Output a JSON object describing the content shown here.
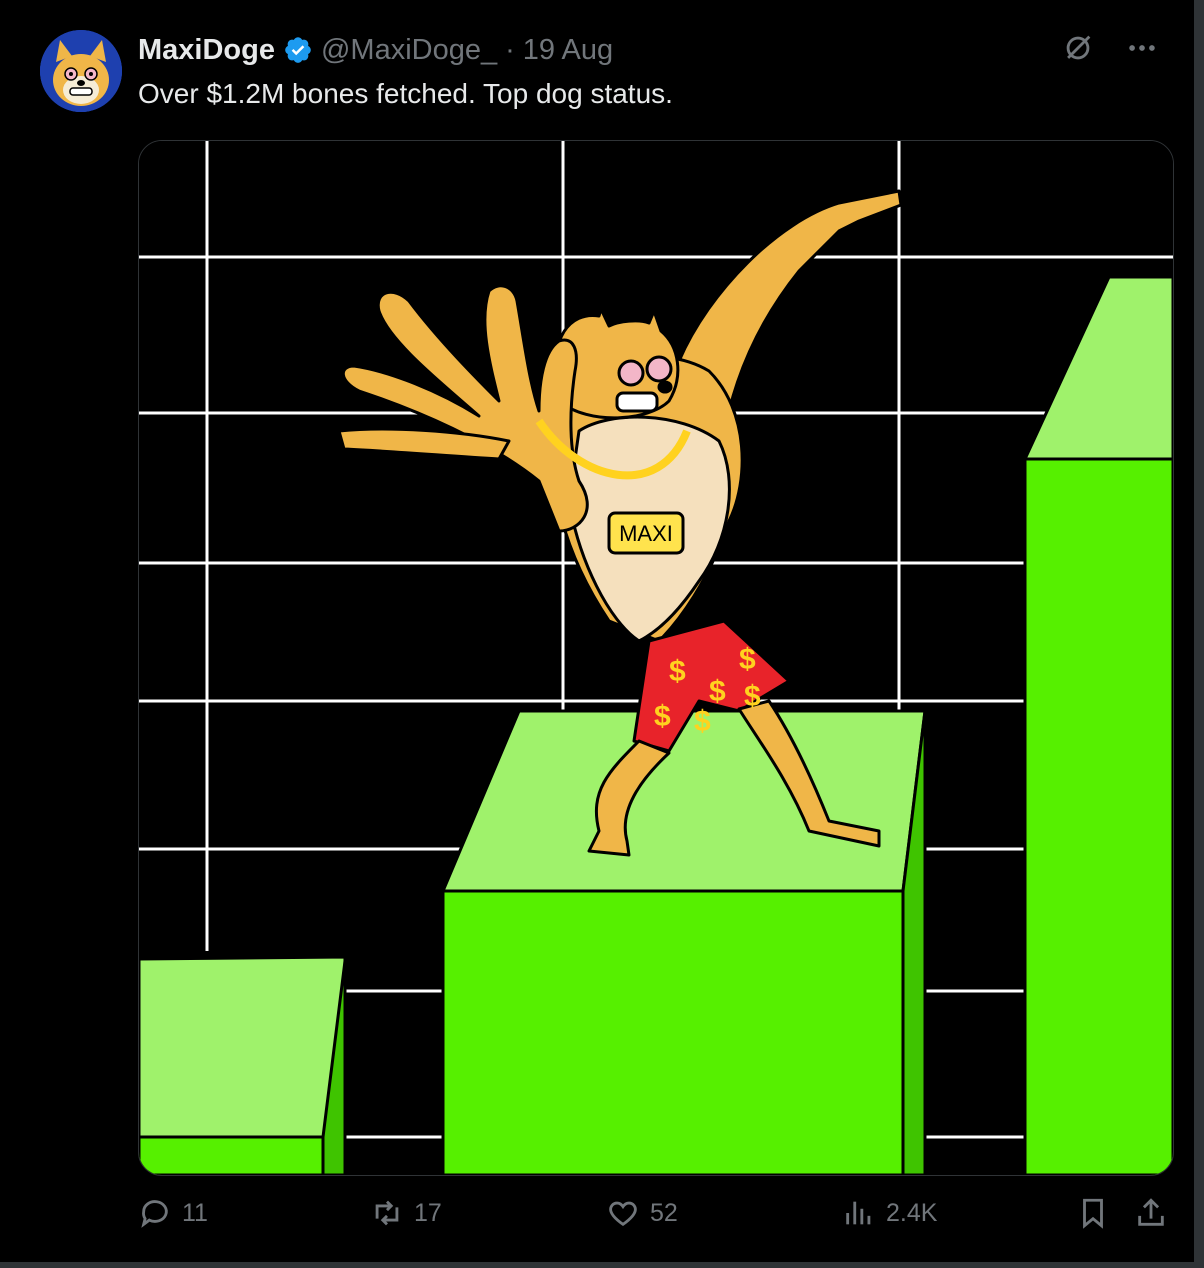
{
  "post": {
    "display_name": "MaxiDoge",
    "handle": "@MaxiDoge_",
    "separator": "·",
    "date": "19 Aug",
    "text": "Over $1.2M bones fetched. Top dog status.",
    "verified": true,
    "verified_color": "#1d9bf0"
  },
  "media": {
    "necklace_tag": "MAXI",
    "shorts_symbols": "$"
  },
  "actions": {
    "replies": "11",
    "reposts": "17",
    "likes": "52",
    "views": "2.4K"
  },
  "icons": {
    "grok": "grok-icon",
    "more": "more-icon",
    "reply": "reply-icon",
    "repost": "repost-icon",
    "like": "like-icon",
    "views": "views-icon",
    "bookmark": "bookmark-icon",
    "share": "share-icon"
  },
  "colors": {
    "bar_light": "#9ff26b",
    "bar_bright": "#56f000",
    "muted_text": "#71767b"
  }
}
